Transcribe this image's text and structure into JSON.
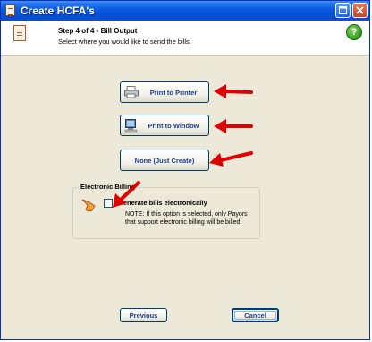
{
  "window": {
    "title": "Create HCFA's"
  },
  "header": {
    "step_title": "Step 4 of 4 - Bill Output",
    "step_description": "Select where you would like to send the bills."
  },
  "icons": {
    "help": "?"
  },
  "output_buttons": {
    "print_to_printer": "Print to Printer",
    "print_to_window": "Print to Window",
    "none_just_create": "None (Just Create)"
  },
  "electronic_billing": {
    "group_title": "Electronic Billing",
    "checkbox_label": "Generate bills electronically",
    "checked": false,
    "note": "NOTE: If this option is selected, only Payors that support electronic billing will be billed."
  },
  "footer": {
    "previous_label": "Previous",
    "cancel_label": "Cancel"
  },
  "colors": {
    "titlebar": "#0a5ce2",
    "annotation_arrow": "#e00000",
    "button_text": "#1c3f8c",
    "dialog_background": "#ece9d8"
  }
}
